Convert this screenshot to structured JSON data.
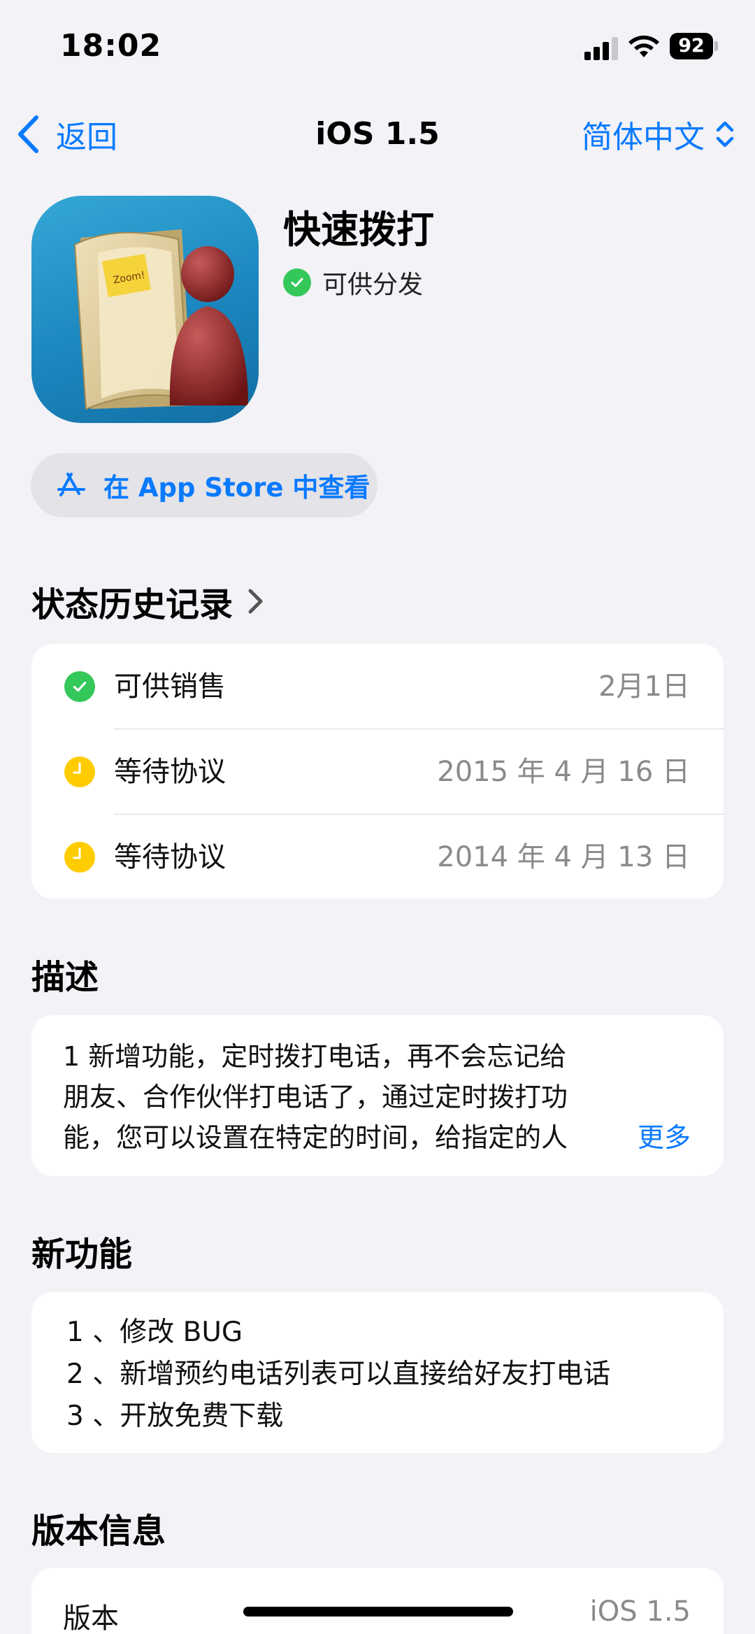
{
  "status_bar": {
    "time": "18:02",
    "battery": "92",
    "icons": [
      "signal-icon",
      "wifi-icon",
      "battery-icon"
    ]
  },
  "nav": {
    "back_label": "返回",
    "title": "iOS 1.5",
    "language_label": "简体中文",
    "icons": [
      "chevron-left-icon",
      "chevron-up-down-icon"
    ]
  },
  "app": {
    "name": "快速拨打",
    "availability": "可供分发",
    "icon": "app-icon-folder-person",
    "icon_note_text": "Zoom!"
  },
  "appstore_button": {
    "label": "在 App Store 中查看",
    "icon": "app-store-icon"
  },
  "history": {
    "title": "状态历史记录",
    "rows": [
      {
        "status": "可供销售",
        "date": "2月1日",
        "icon": "checkmark-circle-icon"
      },
      {
        "status": "等待协议",
        "date": "2015 年 4 月 16 日",
        "icon": "clock-icon"
      },
      {
        "status": "等待协议",
        "date": "2014 年 4 月 13 日",
        "icon": "clock-icon"
      }
    ]
  },
  "description": {
    "title": "描述",
    "lines": [
      "1 新增功能，定时拨打电话，再不会忘记给",
      "朋友、合作伙伴打电话了，通过定时拨打功",
      "能，您可以设置在特定的时间，给指定的人"
    ],
    "more_label": "更多"
  },
  "whats_new": {
    "title": "新功能",
    "lines": [
      "1 、修改 BUG",
      "2 、新增预约电话列表可以直接给好友打电话",
      "3 、开放免费下载"
    ]
  },
  "version_info": {
    "title": "版本信息",
    "rows": [
      {
        "label": "版本",
        "value": "iOS 1.5"
      }
    ]
  },
  "colors": {
    "accent": "#0a7aff",
    "background": "#f2f2f7",
    "success": "#34c759",
    "pending": "#ffcc00",
    "secondary_text": "#8a8a8e"
  }
}
